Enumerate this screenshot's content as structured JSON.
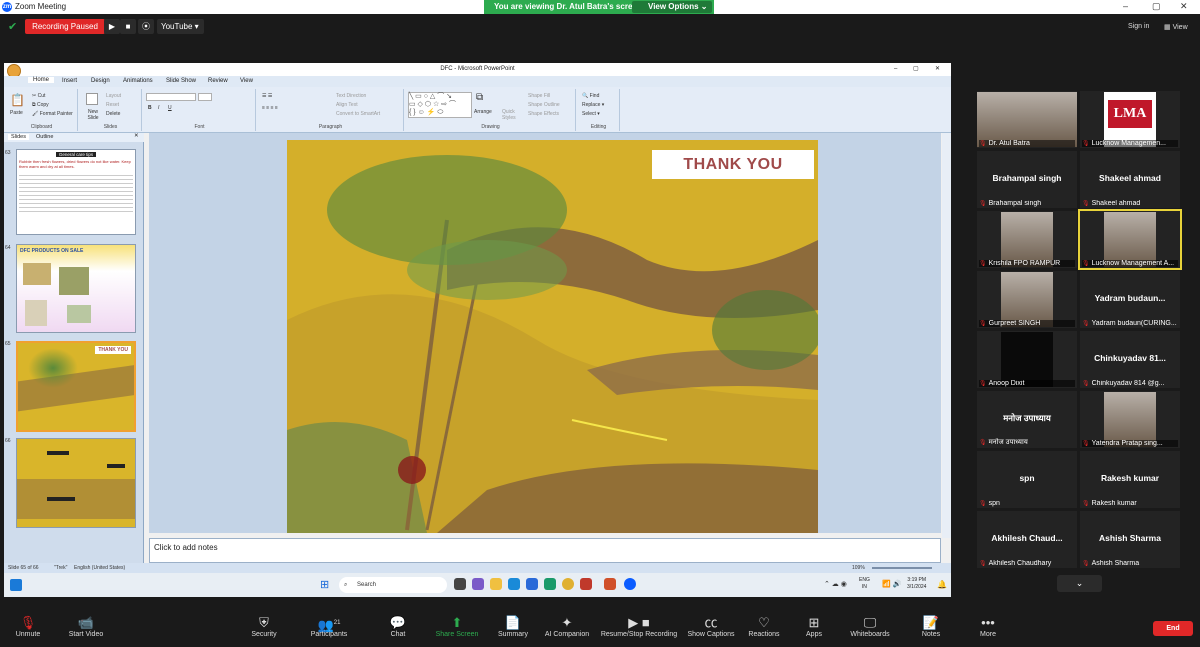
{
  "window": {
    "title": "Zoom Meeting",
    "viewing_banner": "You are viewing Dr. Atul Batra's screen",
    "view_options": "View Options"
  },
  "topbar": {
    "recording": "Recording Paused",
    "youtube": "YouTube",
    "sign_in": "Sign in",
    "view": "View"
  },
  "powerpoint": {
    "title": "DFC - Microsoft PowerPoint",
    "tabs": [
      "Home",
      "Insert",
      "Design",
      "Animations",
      "Slide Show",
      "Review",
      "View"
    ],
    "ribbon_groups": [
      "Clipboard",
      "Slides",
      "Font",
      "Paragraph",
      "Drawing",
      "Editing"
    ],
    "clipboard": {
      "paste": "Paste",
      "cut": "Cut",
      "copy": "Copy",
      "format_painter": "Format Painter"
    },
    "slides_group": {
      "new_slide": "New Slide",
      "layout": "Layout",
      "reset": "Reset",
      "delete": "Delete"
    },
    "paragraph": {
      "text_direction": "Text Direction",
      "align_text": "Align Text",
      "smartart": "Convert to SmartArt"
    },
    "drawing": {
      "arrange": "Arrange",
      "quick_styles": "Quick Styles",
      "shape_fill": "Shape Fill",
      "shape_outline": "Shape Outline",
      "shape_effects": "Shape Effects"
    },
    "editing": {
      "find": "Find",
      "replace": "Replace",
      "select": "Select"
    },
    "pane_tabs": [
      "Slides",
      "Outline"
    ],
    "thumbs": [
      {
        "num": "63",
        "heading": "General care tips",
        "text": "Rubble then fresh flowers, dried flowers do not like water. Keep them warm and dry at all times."
      },
      {
        "num": "64",
        "heading": "DFC PRODUCTS ON SALE",
        "text": ""
      },
      {
        "num": "65",
        "heading": "THANK YOU",
        "text": ""
      },
      {
        "num": "66",
        "heading": "",
        "text": ""
      }
    ],
    "slide_title": "THANK YOU",
    "notes_placeholder": "Click to add notes",
    "status": {
      "slide": "Slide 65 of 66",
      "theme": "\"Trek\"",
      "language": "English (United States)",
      "zoom": "109%"
    },
    "taskbar": {
      "search": "Search",
      "lang": "ENG\nIN",
      "time": "3:19 PM",
      "date": "3/1/2024"
    }
  },
  "participants": [
    {
      "name": "Dr. Atul Batra",
      "display": "",
      "video": "photo"
    },
    {
      "name": "Lucknow Managemen...",
      "display": "",
      "video": "logo"
    },
    {
      "name": "Brahampal singh",
      "display": "Brahampal singh",
      "video": ""
    },
    {
      "name": "Shakeel ahmad",
      "display": "Shakeel ahmad",
      "video": ""
    },
    {
      "name": "Krishila FPO RAMPUR",
      "display": "",
      "video": "photo"
    },
    {
      "name": "Lucknow Management A...",
      "display": "",
      "video": "photo"
    },
    {
      "name": "Gurpreet SINGH",
      "display": "",
      "video": "photo"
    },
    {
      "name": "Yadram budaun(CURING...",
      "display": "Yadram  budaun...",
      "video": ""
    },
    {
      "name": "Anoop Dixit",
      "display": "",
      "video": "dark"
    },
    {
      "name": "Chinkuyadav 814 @g...",
      "display": "Chinkuyadav  81...",
      "video": ""
    },
    {
      "name": "मनोज उपाध्याय",
      "display": "मनोज उपाध्याय",
      "video": ""
    },
    {
      "name": "Yatendra Pratap sing...",
      "display": "",
      "video": "photo"
    },
    {
      "name": "spn",
      "display": "spn",
      "video": ""
    },
    {
      "name": "Rakesh kumar",
      "display": "Rakesh kumar",
      "video": ""
    },
    {
      "name": "Akhilesh Chaudhary",
      "display": "Akhilesh  Chaud...",
      "video": ""
    },
    {
      "name": "Ashish Sharma",
      "display": "Ashish Sharma",
      "video": ""
    }
  ],
  "lma_logo": "LMA",
  "toolbar": {
    "unmute": "Unmute",
    "start_video": "Start Video",
    "security": "Security",
    "participants": "Participants",
    "participants_count": "21",
    "chat": "Chat",
    "share_screen": "Share Screen",
    "summary": "Summary",
    "ai_companion": "AI Companion",
    "resume_recording": "Resume/Stop Recording",
    "captions": "Show Captions",
    "reactions": "Reactions",
    "apps": "Apps",
    "whiteboards": "Whiteboards",
    "notes": "Notes",
    "more": "More",
    "end": "End"
  },
  "colors": {
    "zoom_green": "#2dab4f",
    "zoom_red": "#e02828",
    "zoom_bg": "#1a1a1a",
    "slide_bg": "#d9b52a"
  }
}
